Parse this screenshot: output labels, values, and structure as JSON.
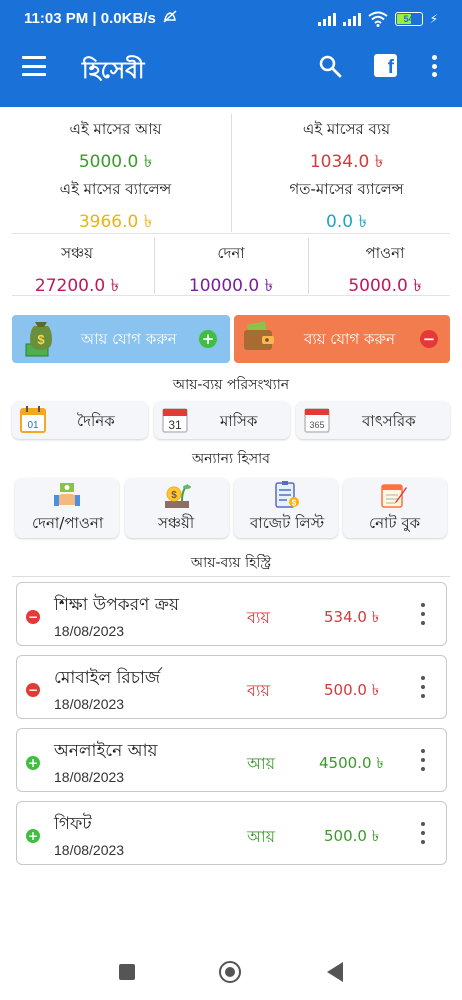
{
  "status_bar": {
    "time": "11:03 PM",
    "speed": "0.0KB/s",
    "battery": "54"
  },
  "app_bar": {
    "title": "হিসেবী"
  },
  "summary": {
    "income_label": "এই মাসের আয়",
    "income_value": "5000.0 ৳",
    "expense_label": "এই মাসের ব্যয়",
    "expense_value": "1034.0 ৳",
    "balance_label": "এই মাসের ব্যালেন্স",
    "balance_value": "3966.0 ৳",
    "prev_balance_label": "গত-মাসের ব্যালেন্স",
    "prev_balance_value": "0.0 ৳",
    "savings_label": "সঞ্চয়",
    "savings_value": "27200.0 ৳",
    "debt_label": "দেনা",
    "debt_value": "10000.0 ৳",
    "receivable_label": "পাওনা",
    "receivable_value": "5000.0 ৳"
  },
  "actions": {
    "add_income": "আয় যোগ করুন",
    "add_expense": "ব্যয় যোগ করুন"
  },
  "stats": {
    "title": "আয়-ব্যয় পরিসংখ্যান",
    "daily": "দৈনিক",
    "monthly": "মাসিক",
    "yearly": "বাৎসরিক",
    "daily_icon_num": "01",
    "monthly_icon_num": "31",
    "yearly_icon_num": "365"
  },
  "other": {
    "title": "অন্যান্য হিসাব",
    "debt_receivable": "দেনা/পাওনা",
    "savings": "সঞ্চয়ী",
    "budget_list": "বাজেট লিস্ট",
    "notebook": "নোট বুক"
  },
  "history": {
    "title": "আয়-ব্যয় হিস্ট্রি",
    "items": [
      {
        "title": "শিক্ষা উপকরণ ক্রয়",
        "date": "18/08/2023",
        "type": "ব্যয়",
        "amount": "534.0 ৳"
      },
      {
        "title": "মোবাইল রিচার্জ",
        "date": "18/08/2023",
        "type": "ব্যয়",
        "amount": "500.0 ৳"
      },
      {
        "title": "অনলাইনে আয়",
        "date": "18/08/2023",
        "type": "আয়",
        "amount": "4500.0 ৳"
      },
      {
        "title": "গিফট",
        "date": "18/08/2023",
        "type": "আয়",
        "amount": "500.0 ৳"
      }
    ]
  },
  "colors": {
    "primary": "#1a72d9",
    "income": "#3a9a2a",
    "expense": "#d23b3b",
    "balance": "#e8b517",
    "prev_balance": "#1aa6c8",
    "savings": "#c2185b",
    "debt": "#7b1fa2",
    "receivable": "#c2185b",
    "income_button": "#8bc3f0",
    "expense_button": "#f37c4f"
  },
  "icons": {
    "menu": "menu-icon",
    "search": "search-icon",
    "facebook": "facebook-icon",
    "more": "more-vert-icon",
    "money_bag": "money-bag-icon",
    "wallet": "wallet-icon",
    "calendar": "calendar-icon",
    "handshake": "handshake-money-icon",
    "savings": "savings-plant-icon",
    "budget": "budget-list-icon",
    "note": "notebook-icon"
  }
}
